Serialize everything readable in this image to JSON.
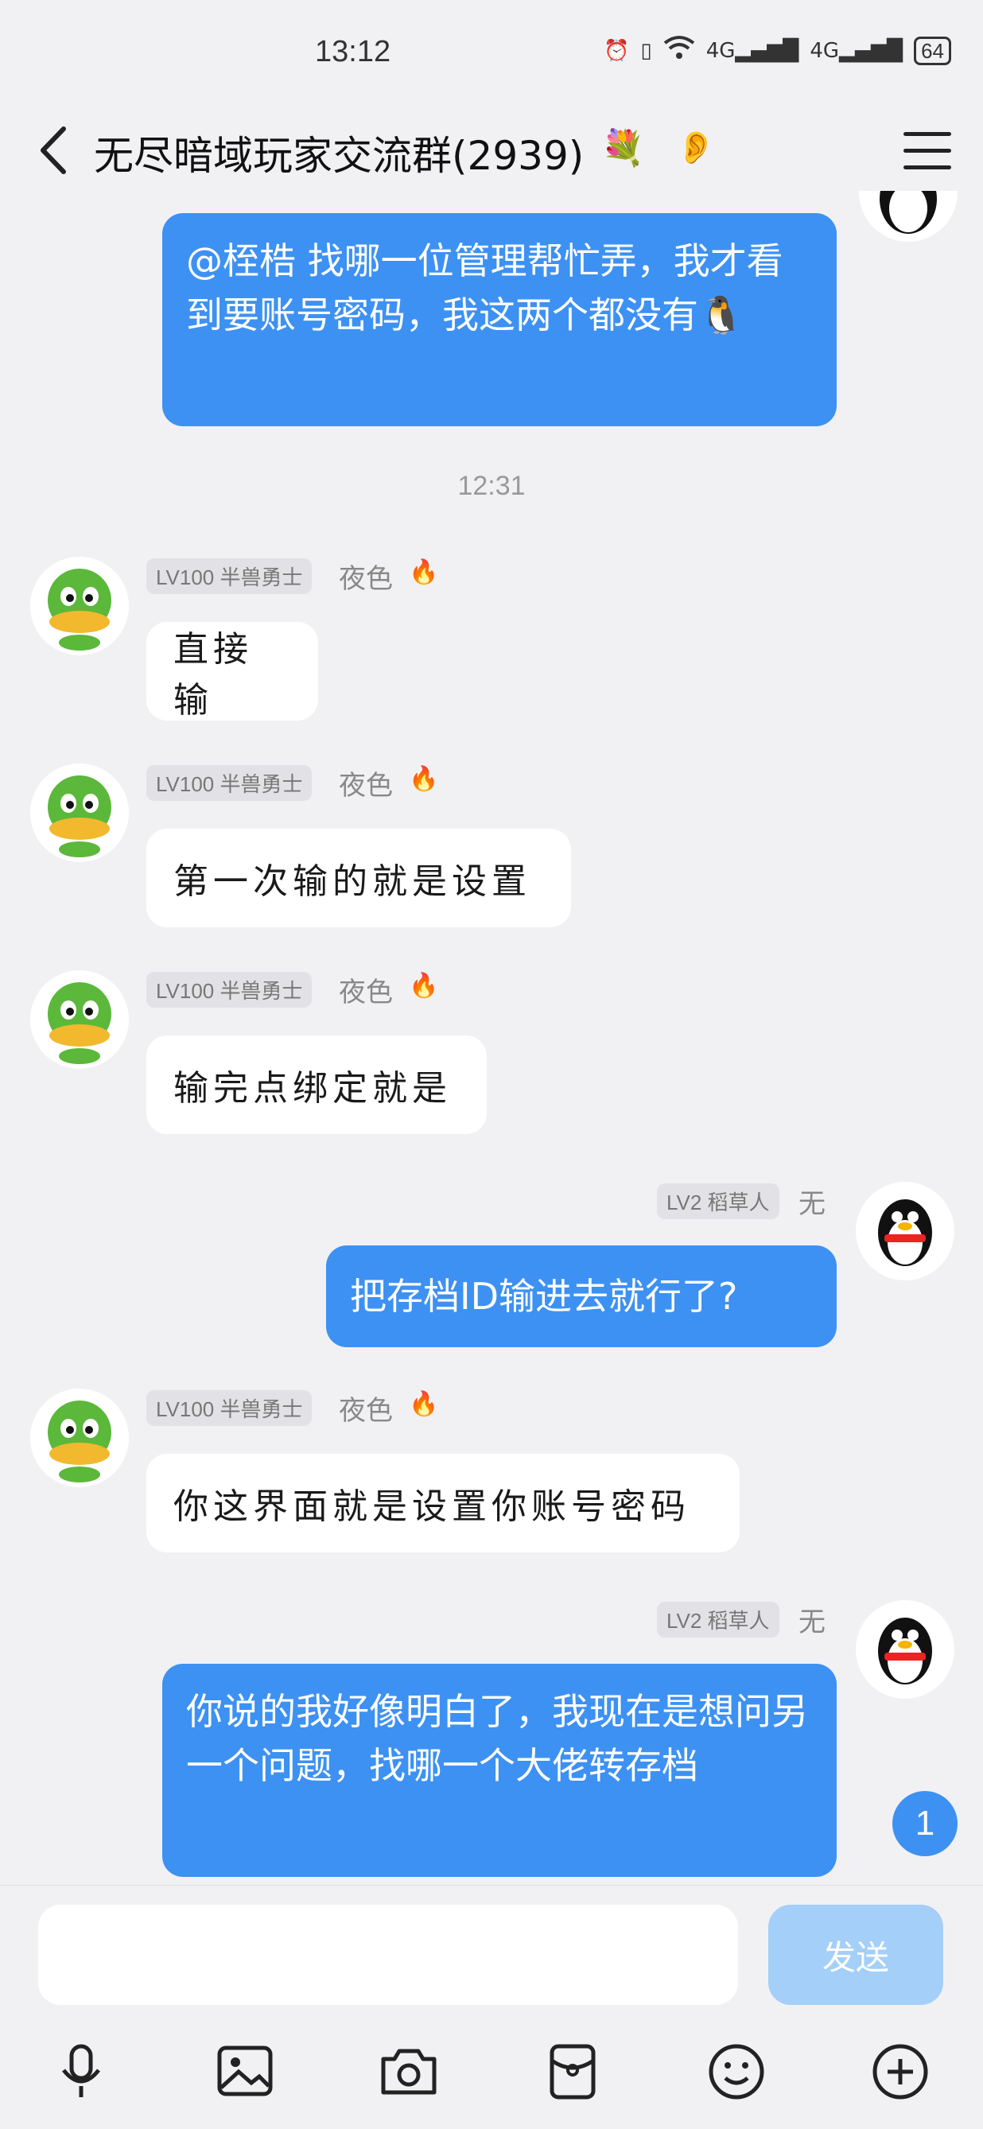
{
  "status": {
    "time": "13:12",
    "net1": "4G",
    "net2": "4G",
    "battery": "64"
  },
  "header": {
    "title": "无尽暗域玩家交流群(2939)",
    "flower_icon": "flower-icon",
    "ear_icon": "ear-icon"
  },
  "messages": {
    "m1": {
      "text": "@桎梏 找哪一位管理帮忙弄，我才看到要账号密码，我这两个都没有🐧"
    },
    "timestamp": "12:31",
    "m2": {
      "badge": "LV100 半兽勇士",
      "name": "夜色",
      "text": "直接输"
    },
    "m3": {
      "badge": "LV100 半兽勇士",
      "name": "夜色",
      "text": "第一次输的就是设置"
    },
    "m4": {
      "badge": "LV100 半兽勇士",
      "name": "夜色",
      "text": "输完点绑定就是"
    },
    "m5": {
      "badge": "LV2 稻草人",
      "name": "无",
      "text": "把存档ID输进去就行了?"
    },
    "m6": {
      "badge": "LV100 半兽勇士",
      "name": "夜色",
      "text": "你这界面就是设置你账号密码"
    },
    "m7": {
      "badge": "LV2 稻草人",
      "name": "无",
      "text": "你说的我好像明白了，我现在是想问另一个问题，找哪一个大佬转存档"
    }
  },
  "unread_count": "1",
  "input": {
    "value": "",
    "send_label": "发送"
  },
  "toolbar": [
    "mic-icon",
    "image-icon",
    "camera-icon",
    "red-packet-icon",
    "emoji-icon",
    "plus-icon"
  ],
  "colors": {
    "bubble_out": "#3d91f2",
    "send_disabled": "#a4cff8",
    "background": "#f1f1f4"
  }
}
